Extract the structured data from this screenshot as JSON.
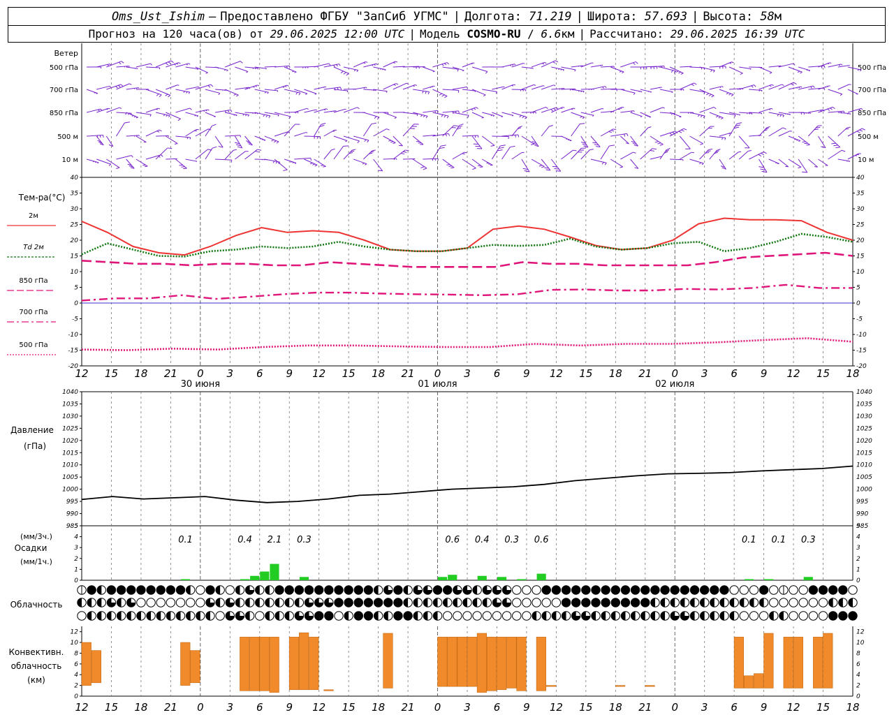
{
  "header": {
    "station": "Oms_Ust_Ishim",
    "dash": "–",
    "provided": "Предоставлено ФГБУ \"ЗапСиб УГМС\"",
    "lon_label": "Долгота:",
    "lon": "71.219",
    "lat_label": "Широта:",
    "lat": "57.693",
    "alt_label": "Высота:",
    "alt": "58",
    "alt_unit": "м",
    "forecast_label": "Прогноз на 120 часа(ов) от",
    "init_time": "29.06.2025 12:00 UTC",
    "model_label": "Модель",
    "model": "COSMO-RU",
    "resolution": "6.6",
    "res_unit": "км",
    "calc_label": "Рассчитано:",
    "calc_time": "29.06.2025 16:39 UTC"
  },
  "panels": {
    "wind": {
      "title": "Ветер",
      "levels": [
        "500 гПа",
        "700 гПа",
        "850 гПа",
        "500 м",
        "10 м"
      ]
    },
    "temperature": {
      "title": "Тем-ра(°C)",
      "legend": [
        {
          "label": "2м",
          "color": "#ee3333"
        },
        {
          "label": "Td 2м",
          "color": "#117711"
        },
        {
          "label": "850 гПа",
          "color": "#e0157a"
        },
        {
          "label": "700 гПа",
          "color": "#e0157a"
        },
        {
          "label": "500 гПа",
          "color": "#e0157a"
        }
      ]
    },
    "pressure": {
      "title": "Давление",
      "unit": "(гПа)"
    },
    "precip": {
      "unit_3h": "(мм/3ч.)",
      "title": "Осадки",
      "unit_1h": "(мм/1ч.)"
    },
    "clouds": {
      "title": "Облачность"
    },
    "convective": {
      "title1": "Конвективн.",
      "title2": "облачность",
      "unit": "(км)"
    }
  },
  "time_axis": {
    "hour_labels": [
      "12",
      "15",
      "18",
      "21",
      "0",
      "3",
      "6",
      "9",
      "12",
      "15",
      "18",
      "21",
      "0",
      "3",
      "6",
      "9",
      "12",
      "15",
      "18",
      "21",
      "0",
      "3",
      "6",
      "9",
      "12",
      "15",
      "18"
    ],
    "date_labels": [
      {
        "text": "30 июня",
        "hour": 12
      },
      {
        "text": "01 июля",
        "hour": 36
      },
      {
        "text": "02 июля",
        "hour": 60
      }
    ]
  },
  "chart_data": [
    {
      "type": "line",
      "title": "Тем-ра(°C)",
      "ylim": [
        -20,
        40
      ],
      "yticks": [
        -20,
        -15,
        -10,
        -5,
        0,
        5,
        10,
        15,
        20,
        25,
        30,
        35,
        40
      ],
      "x_unit": "hours from 29.06.2025 12:00 UTC",
      "x": [
        0,
        3,
        6,
        9,
        12,
        15,
        18,
        21,
        24,
        27,
        30,
        33,
        36,
        39,
        42,
        45,
        48,
        51,
        54,
        57,
        60,
        63,
        66,
        69,
        72,
        75,
        78
      ],
      "series": [
        {
          "name": "2м",
          "color": "#ee3333",
          "style": "solid",
          "values": [
            26,
            22.5,
            18,
            16,
            15.3,
            18,
            21.5,
            24,
            22.5,
            23,
            22.5,
            20,
            17,
            16.5,
            16.5,
            17.5,
            23.5,
            24.5,
            23.5,
            21,
            18.3,
            17,
            17.5,
            20,
            25.2,
            27,
            26.5,
            26.5,
            26.2,
            22.5,
            20
          ]
        },
        {
          "name": "Td 2м",
          "color": "#117711",
          "style": "dotted",
          "values": [
            15.5,
            19,
            17,
            15,
            14.8,
            16.5,
            17,
            18,
            17.5,
            18,
            19.5,
            18,
            17,
            16.5,
            16.5,
            17.5,
            18.5,
            18.2,
            18.5,
            20.5,
            18,
            17,
            17.5,
            19,
            19.5,
            16.5,
            17.5,
            19.5,
            22,
            21,
            19.5
          ]
        },
        {
          "name": "850 гПа",
          "color": "#e0157a",
          "style": "dashed",
          "values": [
            13.5,
            13,
            12.5,
            12.5,
            12,
            12.5,
            12.5,
            12,
            12,
            13,
            12.5,
            12,
            11.5,
            11.5,
            11.5,
            11.5,
            13,
            12.5,
            12.5,
            12,
            12,
            12,
            12,
            13,
            14.5,
            15,
            15.5,
            16,
            15
          ]
        },
        {
          "name": "700 гПа",
          "color": "#e0157a",
          "style": "dashdot",
          "values": [
            0.8,
            1.5,
            1.5,
            2.5,
            1.3,
            2,
            2.8,
            3.3,
            3.3,
            3,
            2.8,
            2.7,
            2.5,
            2.8,
            4.2,
            4.3,
            4,
            4,
            4.5,
            4.3,
            4.8,
            5.8,
            4.8,
            4.8
          ]
        },
        {
          "name": "500 гПа",
          "color": "#e0157a",
          "style": "dotted",
          "values": [
            -14.8,
            -15,
            -14.5,
            -14.8,
            -14,
            -13.5,
            -13.5,
            -13.8,
            -14,
            -14,
            -13,
            -13.5,
            -13,
            -13,
            -12.5,
            -11.8,
            -11.2,
            -12.3
          ]
        }
      ]
    },
    {
      "type": "line",
      "title": "Давление",
      "ylim": [
        985,
        1040
      ],
      "yticks": [
        985,
        990,
        995,
        1000,
        1005,
        1010,
        1015,
        1020,
        1025,
        1030,
        1035,
        1040
      ],
      "x": [
        0,
        3,
        6,
        9,
        12,
        15,
        18,
        21,
        24,
        27,
        30,
        33,
        36,
        39,
        42,
        45,
        48,
        51,
        54,
        57,
        60,
        63,
        66,
        69,
        72,
        75,
        78
      ],
      "values": [
        995.8,
        997,
        996,
        996.5,
        997,
        995.5,
        994.5,
        995,
        996,
        997.5,
        998,
        999,
        1000,
        1000.5,
        1001,
        1002,
        1003.5,
        1004.5,
        1005.5,
        1006.3,
        1006.5,
        1006.8,
        1007.5,
        1008,
        1008.5,
        1009.5
      ]
    },
    {
      "type": "bar",
      "title": "Осадки",
      "ylim": [
        0,
        5
      ],
      "bars_mm_per_hour": [
        {
          "hour": 10,
          "value": 0.1
        },
        {
          "hour": 16,
          "value": 0.1
        },
        {
          "hour": 17,
          "value": 0.4
        },
        {
          "hour": 18,
          "value": 0.8
        },
        {
          "hour": 19,
          "value": 1.5
        },
        {
          "hour": 22,
          "value": 0.3
        },
        {
          "hour": 36,
          "value": 0.3
        },
        {
          "hour": 37,
          "value": 0.5
        },
        {
          "hour": 40,
          "value": 0.4
        },
        {
          "hour": 42,
          "value": 0.3
        },
        {
          "hour": 44,
          "value": 0.1
        },
        {
          "hour": 46,
          "value": 0.6
        },
        {
          "hour": 67,
          "value": 0.1
        },
        {
          "hour": 69,
          "value": 0.1
        },
        {
          "hour": 73,
          "value": 0.3
        }
      ],
      "labels_3h": [
        {
          "hour": 10.5,
          "text": "0.1"
        },
        {
          "hour": 16.5,
          "text": "0.4"
        },
        {
          "hour": 19.5,
          "text": "2.1"
        },
        {
          "hour": 22.5,
          "text": "0.3"
        },
        {
          "hour": 37.5,
          "text": "0.6"
        },
        {
          "hour": 40.5,
          "text": "0.4"
        },
        {
          "hour": 43.5,
          "text": "0.3"
        },
        {
          "hour": 46.5,
          "text": "0.6"
        },
        {
          "hour": 67.5,
          "text": "0.1"
        },
        {
          "hour": 70.5,
          "text": "0.1"
        },
        {
          "hour": 73.5,
          "text": "0.3"
        }
      ]
    },
    {
      "type": "bar",
      "title": "Конвективн. облачность",
      "ylim": [
        0,
        13
      ],
      "yticks": [
        0,
        2,
        4,
        6,
        8,
        10,
        12
      ],
      "bars_km": [
        {
          "hour": 0.5,
          "base": 2,
          "top": 10
        },
        {
          "hour": 1.5,
          "base": 2.5,
          "top": 8.5
        },
        {
          "hour": 10.5,
          "base": 2,
          "top": 10
        },
        {
          "hour": 11.5,
          "base": 2.5,
          "top": 8.5
        },
        {
          "hour": 16.5,
          "base": 1,
          "top": 11
        },
        {
          "hour": 17.5,
          "base": 1,
          "top": 11
        },
        {
          "hour": 18.5,
          "base": 1,
          "top": 11
        },
        {
          "hour": 19.5,
          "base": 0.7,
          "top": 11
        },
        {
          "hour": 21.5,
          "base": 1.2,
          "top": 11
        },
        {
          "hour": 22.5,
          "base": 1.2,
          "top": 11.8
        },
        {
          "hour": 23.5,
          "base": 1.2,
          "top": 11
        },
        {
          "hour": 25,
          "base": 1,
          "top": 1.2
        },
        {
          "hour": 31,
          "base": 1.5,
          "top": 11.7
        },
        {
          "hour": 36.5,
          "base": 1.8,
          "top": 11
        },
        {
          "hour": 37.5,
          "base": 1.8,
          "top": 11
        },
        {
          "hour": 38.5,
          "base": 1.8,
          "top": 11
        },
        {
          "hour": 39.5,
          "base": 1.8,
          "top": 11
        },
        {
          "hour": 40.5,
          "base": 0.7,
          "top": 11.7
        },
        {
          "hour": 41.5,
          "base": 1,
          "top": 11
        },
        {
          "hour": 42.5,
          "base": 1.2,
          "top": 11
        },
        {
          "hour": 43.5,
          "base": 1.5,
          "top": 11
        },
        {
          "hour": 44.5,
          "base": 1,
          "top": 11
        },
        {
          "hour": 46.5,
          "base": 1,
          "top": 11
        },
        {
          "hour": 47.5,
          "base": 1.8,
          "top": 2
        },
        {
          "hour": 54.5,
          "base": 1.8,
          "top": 2
        },
        {
          "hour": 57.5,
          "base": 1.8,
          "top": 2
        },
        {
          "hour": 66.5,
          "base": 1.5,
          "top": 11
        },
        {
          "hour": 67.5,
          "base": 1.5,
          "top": 3.8
        },
        {
          "hour": 68.5,
          "base": 1.5,
          "top": 4.2
        },
        {
          "hour": 69.5,
          "base": 1.5,
          "top": 11.7
        },
        {
          "hour": 71.5,
          "base": 1.5,
          "top": 11
        },
        {
          "hour": 72.5,
          "base": 1.5,
          "top": 11
        },
        {
          "hour": 74.5,
          "base": 1.5,
          "top": 11
        },
        {
          "hour": 75.5,
          "base": 1.5,
          "top": 11.7
        }
      ]
    }
  ],
  "cloud_rows": {
    "levels_encoding": "0=clear .. 4=overcast, 2=half",
    "row1": [
      1,
      4,
      2,
      4,
      4,
      4,
      4,
      4,
      4,
      4,
      4,
      2,
      0,
      4,
      2,
      0,
      2,
      3,
      2,
      2,
      4,
      4,
      4,
      4,
      4,
      4,
      4,
      4,
      4,
      4,
      2,
      3,
      4,
      2,
      3,
      3,
      4,
      4,
      3,
      3,
      2,
      3,
      3,
      3,
      0,
      0,
      0,
      4,
      4,
      4,
      4,
      4,
      4,
      4,
      4,
      4,
      4,
      4,
      4,
      4,
      4,
      4,
      4,
      4,
      4,
      4,
      0,
      0,
      0,
      4,
      0,
      1,
      0,
      0,
      4,
      4,
      4,
      4,
      0,
      2,
      4,
      2,
      4,
      4,
      4,
      4,
      2,
      0,
      0,
      2,
      0,
      0,
      4,
      4,
      4,
      4,
      4,
      4,
      4,
      4,
      4,
      4,
      4,
      4,
      4,
      4,
      4,
      4,
      4,
      2,
      3,
      3,
      3,
      4,
      4,
      4,
      4,
      4,
      4
    ],
    "row2": [
      2,
      2,
      2,
      3,
      2,
      3,
      0,
      0,
      0,
      0,
      0,
      0,
      0,
      3,
      2,
      3,
      2,
      2,
      2,
      2,
      2,
      2,
      2,
      3,
      3,
      3,
      4,
      4,
      4,
      4,
      4,
      4,
      4,
      2,
      2,
      2,
      2,
      2,
      2,
      2,
      2,
      2,
      3,
      3,
      0,
      0,
      0,
      0,
      0,
      4,
      4,
      4,
      4,
      4,
      4,
      4,
      4,
      4,
      2,
      2,
      2,
      2,
      2,
      2,
      2,
      2,
      2,
      2,
      2,
      2,
      0,
      0,
      0,
      0,
      0,
      0,
      2,
      2,
      2,
      2,
      2,
      2,
      2,
      2,
      2,
      2,
      2,
      2,
      0,
      0,
      0,
      0,
      0,
      0,
      0,
      0,
      2,
      2,
      2,
      2,
      2,
      2,
      2,
      0,
      0,
      0,
      0,
      0,
      0,
      0,
      0,
      4,
      2,
      2,
      2,
      2,
      2,
      3,
      3
    ],
    "row3": [
      0,
      2,
      2,
      2,
      2,
      2,
      2,
      2,
      2,
      2,
      2,
      2,
      2,
      2,
      0,
      3,
      3,
      2,
      0,
      2,
      2,
      2,
      3,
      3,
      4,
      4,
      0,
      2,
      4,
      4,
      2,
      2,
      4,
      4,
      2,
      2,
      2,
      0,
      0,
      0,
      0,
      0,
      0,
      0,
      0,
      0,
      2,
      2,
      2,
      2,
      3,
      3,
      2,
      2,
      2,
      2,
      2,
      2,
      2,
      2,
      3,
      3,
      2,
      2,
      2,
      2,
      2,
      0,
      0,
      0,
      2,
      2,
      0,
      0,
      0,
      0,
      4,
      4,
      4,
      4,
      4,
      4,
      4,
      4,
      4,
      4,
      4,
      0,
      0,
      0,
      0,
      0,
      0,
      0,
      0,
      2,
      2,
      2,
      2,
      0,
      0,
      0,
      0,
      0,
      0,
      0,
      0,
      0,
      0,
      2,
      2,
      0,
      0,
      0,
      0,
      0,
      0,
      0,
      0
    ]
  },
  "wind_barbs_color": "#7722cc",
  "plot_colors": {
    "grid": "#777777",
    "zero_line": "#3333cc",
    "precip": "#22cc22",
    "convective": "#f08a2a"
  }
}
